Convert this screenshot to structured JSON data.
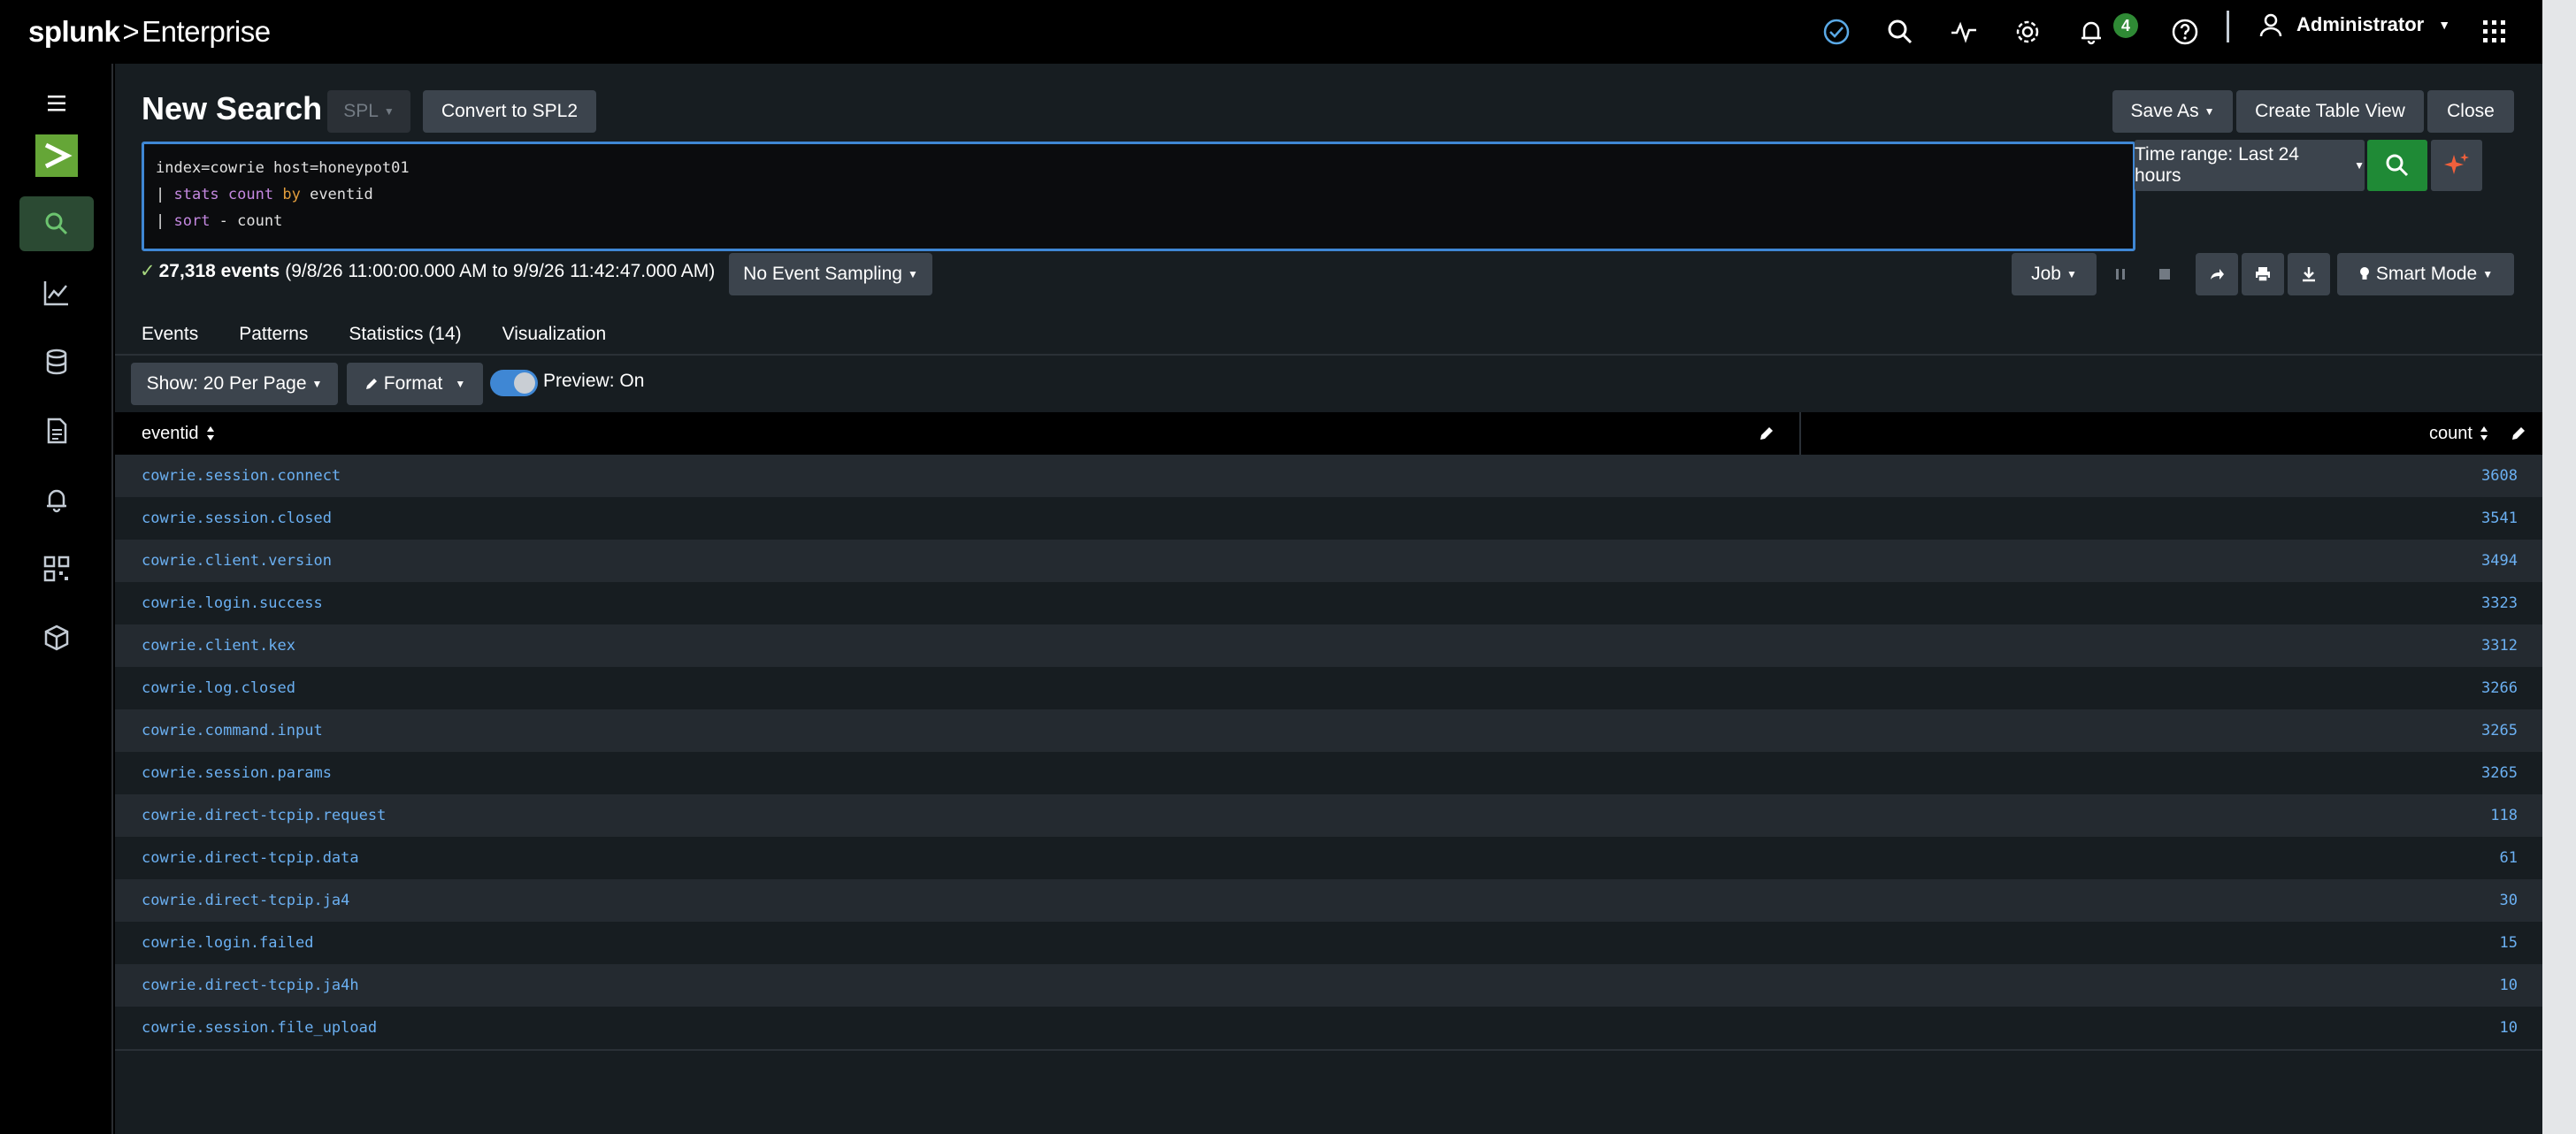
{
  "brand": {
    "name": "splunk",
    "separator": ">",
    "product": "Enterprise"
  },
  "topbar": {
    "notification_count": "4",
    "user": "Administrator",
    "icons": [
      "check-circle-icon",
      "search-icon",
      "activity-icon",
      "gear-icon",
      "bell-icon",
      "help-icon",
      "user-icon",
      "apps-grid-icon"
    ]
  },
  "leftnav": {
    "items": [
      "menu-icon",
      "splunk-logo",
      "search-icon",
      "chart-icon",
      "database-icon",
      "document-icon",
      "bell-icon",
      "apps-icon",
      "package-icon"
    ]
  },
  "header": {
    "title": "New Search",
    "spl_label": "SPL",
    "convert_label": "Convert to SPL2",
    "save_as_label": "Save As",
    "create_table_label": "Create Table View",
    "close_label": "Close"
  },
  "query": {
    "line1": "index=cowrie host=honeypot01",
    "line2_pipe": "| ",
    "line2_cmd": "stats",
    "line2_fn": "count",
    "line2_by": "by",
    "line2_field": " eventid",
    "line3_pipe": "| ",
    "line3_cmd": "sort",
    "line3_rest": " - count"
  },
  "timerange": {
    "label": "Time range: Last 24 hours"
  },
  "status": {
    "events": "27,318 events",
    "range": "(9/8/26 11:00:00.000 AM to 9/9/26 11:42:47.000 AM)",
    "sampling_label": "No Event Sampling",
    "job_label": "Job",
    "mode_label": "Smart Mode"
  },
  "tabs": [
    {
      "label": "Events"
    },
    {
      "label": "Patterns"
    },
    {
      "label": "Statistics (14)"
    },
    {
      "label": "Visualization"
    }
  ],
  "controls": {
    "show_label": "Show: 20 Per Page",
    "format_label": "Format",
    "preview_label": "Preview: On"
  },
  "table": {
    "columns": [
      "eventid",
      "count"
    ],
    "rows": [
      {
        "eventid": "cowrie.session.connect",
        "count": "3608"
      },
      {
        "eventid": "cowrie.session.closed",
        "count": "3541"
      },
      {
        "eventid": "cowrie.client.version",
        "count": "3494"
      },
      {
        "eventid": "cowrie.login.success",
        "count": "3323"
      },
      {
        "eventid": "cowrie.client.kex",
        "count": "3312"
      },
      {
        "eventid": "cowrie.log.closed",
        "count": "3266"
      },
      {
        "eventid": "cowrie.command.input",
        "count": "3265"
      },
      {
        "eventid": "cowrie.session.params",
        "count": "3265"
      },
      {
        "eventid": "cowrie.direct-tcpip.request",
        "count": "118"
      },
      {
        "eventid": "cowrie.direct-tcpip.data",
        "count": "61"
      },
      {
        "eventid": "cowrie.direct-tcpip.ja4",
        "count": "30"
      },
      {
        "eventid": "cowrie.login.failed",
        "count": "15"
      },
      {
        "eventid": "cowrie.direct-tcpip.ja4h",
        "count": "10"
      },
      {
        "eventid": "cowrie.session.file_upload",
        "count": "10"
      }
    ]
  },
  "colors": {
    "accent": "#3f87d4",
    "success": "#1f8a36",
    "link": "#6bb0f2",
    "background": "#171d21"
  }
}
